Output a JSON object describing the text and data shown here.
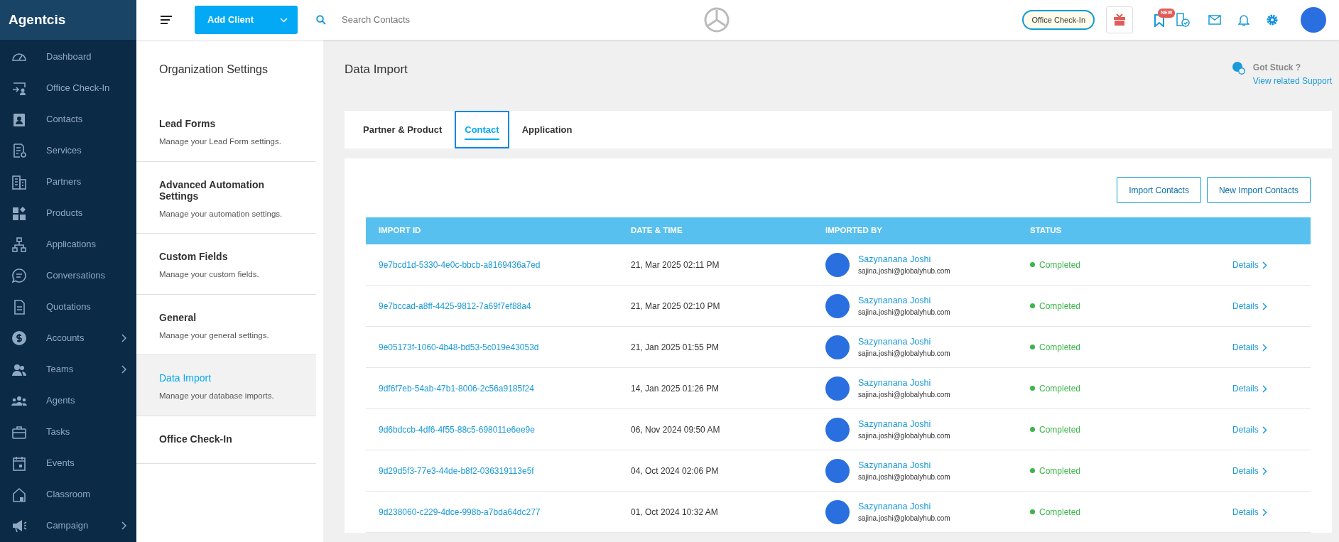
{
  "app": {
    "brand": "Agentcis"
  },
  "sidebar": {
    "items": [
      {
        "label": "Dashboard",
        "has_submenu": false
      },
      {
        "label": "Office Check-In",
        "has_submenu": false
      },
      {
        "label": "Contacts",
        "has_submenu": false
      },
      {
        "label": "Services",
        "has_submenu": false
      },
      {
        "label": "Partners",
        "has_submenu": false
      },
      {
        "label": "Products",
        "has_submenu": false
      },
      {
        "label": "Applications",
        "has_submenu": false
      },
      {
        "label": "Conversations",
        "has_submenu": false
      },
      {
        "label": "Quotations",
        "has_submenu": false
      },
      {
        "label": "Accounts",
        "has_submenu": true
      },
      {
        "label": "Teams",
        "has_submenu": true
      },
      {
        "label": "Agents",
        "has_submenu": false
      },
      {
        "label": "Tasks",
        "has_submenu": false
      },
      {
        "label": "Events",
        "has_submenu": false
      },
      {
        "label": "Classroom",
        "has_submenu": false
      },
      {
        "label": "Campaign",
        "has_submenu": true
      }
    ]
  },
  "topbar": {
    "add_button": "Add Client",
    "search": {
      "placeholder": "Search Contacts"
    },
    "office_checkin": "Office Check-In",
    "new_badge": "NEW"
  },
  "settings_panel": {
    "title": "Organization Settings",
    "items": [
      {
        "title": "Lead Forms",
        "description": "Manage your Lead Form settings.",
        "selected": false
      },
      {
        "title": "Advanced Automation Settings",
        "description": "Manage your automation settings.",
        "selected": false
      },
      {
        "title": "Custom Fields",
        "description": "Manage your custom fields.",
        "selected": false
      },
      {
        "title": "General",
        "description": "Manage your general settings.",
        "selected": false
      },
      {
        "title": "Data Import",
        "description": "Manage your database imports.",
        "selected": true
      },
      {
        "title": "Office Check-In",
        "selected": false
      }
    ]
  },
  "page": {
    "title": "Data Import",
    "help": {
      "question": "Got Stuck ?",
      "link": "View related Support"
    }
  },
  "tabs": [
    {
      "label": "Partner & Product",
      "selected": false
    },
    {
      "label": "Contact",
      "selected": true
    },
    {
      "label": "Application",
      "selected": false
    }
  ],
  "actions": [
    "Import Contacts",
    "New Import Contacts"
  ],
  "table": {
    "columns": [
      "IMPORT ID",
      "DATE & TIME",
      "IMPORTED BY",
      "STATUS"
    ],
    "rows": [
      {
        "import_id": "9e7bcd1d-5330-4e0c-bbcb-a8169436a7ed",
        "date_time": "21, Mar 2025 02:11 PM",
        "user_name": "Sazynanana Joshi",
        "user_email": "sajina.joshi@globalyhub.com",
        "status": "Completed",
        "action": "Details"
      },
      {
        "import_id": "9e7bccad-a8ff-4425-9812-7a69f7ef88a4",
        "date_time": "21, Mar 2025 02:10 PM",
        "user_name": "Sazynanana Joshi",
        "user_email": "sajina.joshi@globalyhub.com",
        "status": "Completed",
        "action": "Details"
      },
      {
        "import_id": "9e05173f-1060-4b48-bd53-5c019e43053d",
        "date_time": "21, Jan 2025 01:55 PM",
        "user_name": "Sazynanana Joshi",
        "user_email": "sajina.joshi@globalyhub.com",
        "status": "Completed",
        "action": "Details"
      },
      {
        "import_id": "9df6f7eb-54ab-47b1-8006-2c56a9185f24",
        "date_time": "14, Jan 2025 01:26 PM",
        "user_name": "Sazynanana Joshi",
        "user_email": "sajina.joshi@globalyhub.com",
        "status": "Completed",
        "action": "Details"
      },
      {
        "import_id": "9d6bdccb-4df6-4f55-88c5-698011e6ee9e",
        "date_time": "06, Nov 2024 09:50 AM",
        "user_name": "Sazynanana Joshi",
        "user_email": "sajina.joshi@globalyhub.com",
        "status": "Completed",
        "action": "Details"
      },
      {
        "import_id": "9d29d5f3-77e3-44de-b8f2-036319113e5f",
        "date_time": "04, Oct 2024 02:06 PM",
        "user_name": "Sazynanana Joshi",
        "user_email": "sajina.joshi@globalyhub.com",
        "status": "Completed",
        "action": "Details"
      },
      {
        "import_id": "9d238060-c229-4dce-998b-a7bda64dc277",
        "date_time": "01, Oct 2024 10:32 AM",
        "user_name": "Sazynanana Joshi",
        "user_email": "sajina.joshi@globalyhub.com",
        "status": "Completed",
        "action": "Details"
      }
    ]
  }
}
